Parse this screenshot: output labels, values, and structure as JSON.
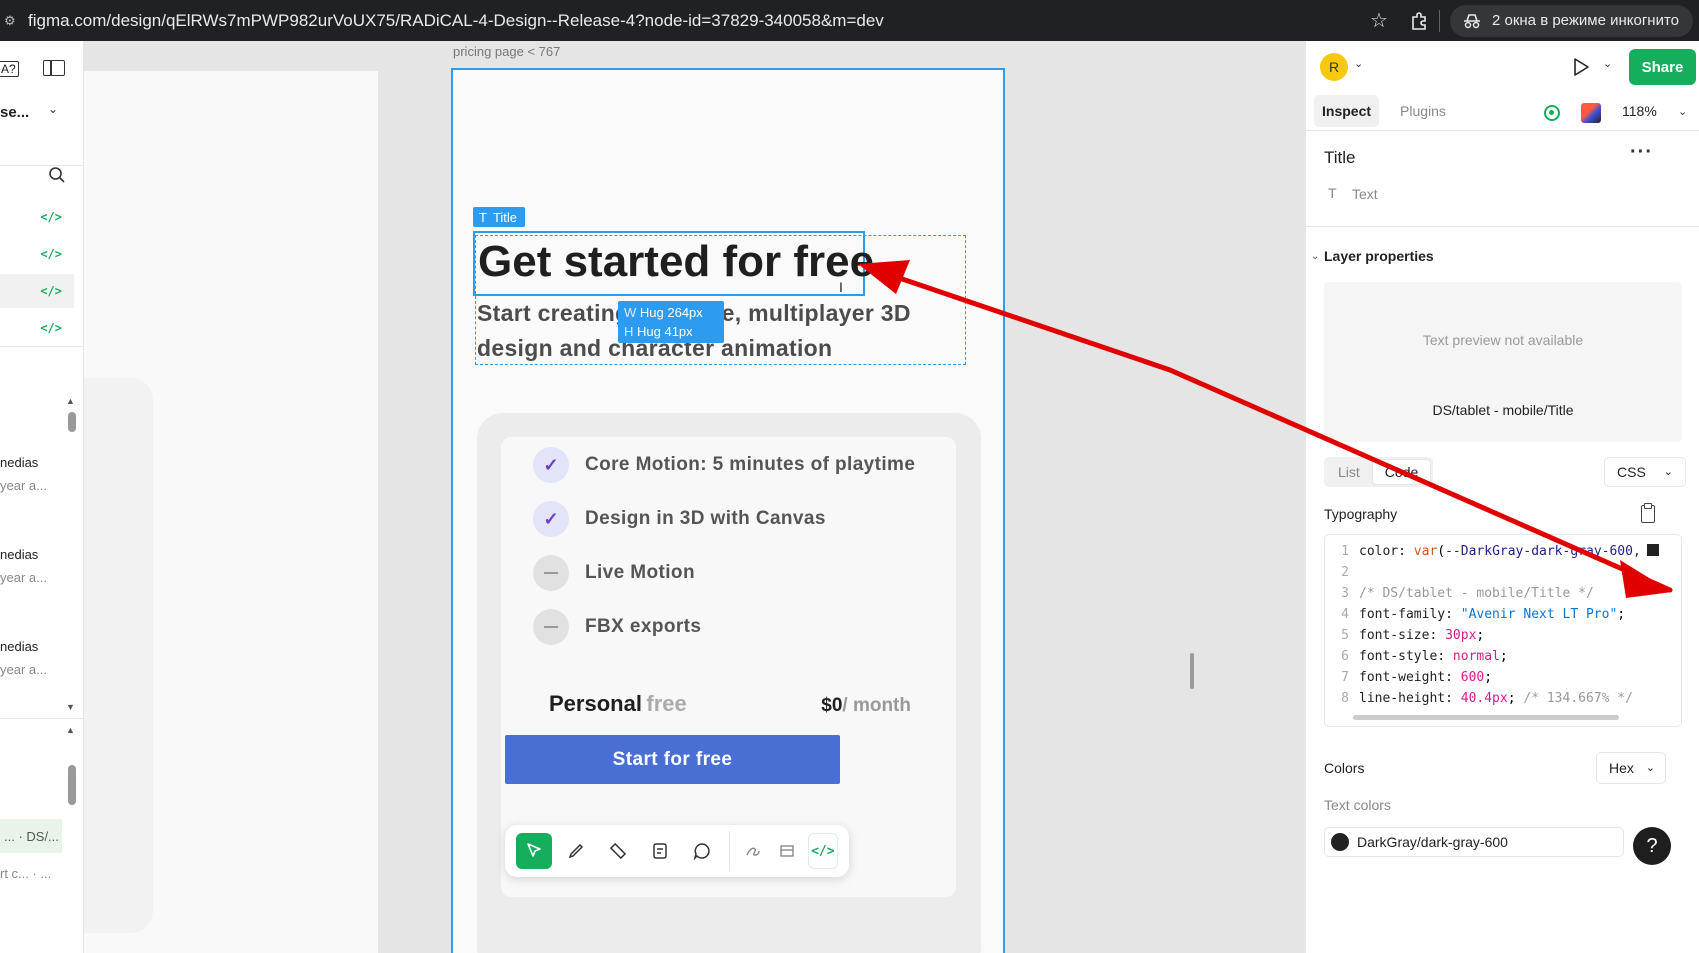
{
  "browser": {
    "url": "figma.com/design/qElRWs7mPWP982urVoUX75/RADiCAL-4-Design--Release-4?node-id=37829-340058&m=dev",
    "incognito_label": "2 окна в режиме инкогнито"
  },
  "left_panel": {
    "file_name": "se...",
    "code_glyph": "</>",
    "items": [
      {
        "title": "nedias",
        "subtitle": "year a..."
      },
      {
        "title": "nedias",
        "subtitle": "year a..."
      },
      {
        "title": "nedias",
        "subtitle": "year a..."
      }
    ],
    "selected_item": "... · DS/...",
    "bottom_item": "rt c... · ..."
  },
  "canvas": {
    "frame_label": "pricing page < 767",
    "title_badge": "Title",
    "title_text": "Get started for free",
    "subtitle_text": "Start creating real-time, multiplayer 3D design and character animation",
    "dim_badge": {
      "w_label": "W",
      "w_value": "Hug 264px",
      "h_label": "H",
      "h_value": "Hug 41px"
    },
    "features": [
      {
        "text": "Core Motion: 5 minutes of playtime",
        "included": true
      },
      {
        "text": "Design in 3D with Canvas",
        "included": true
      },
      {
        "text": "Live Motion",
        "included": false
      },
      {
        "text": "FBX exports",
        "included": false
      }
    ],
    "plan": {
      "name": "Personal",
      "tier": "free",
      "price": "$0",
      "period": "/ month"
    },
    "cta_label": "Start for free",
    "accent_color": "#2d9bf0",
    "button_color": "#4a6fd4"
  },
  "toolbar": {
    "tools": [
      "move-tool",
      "pen-tool",
      "measure-tool",
      "annotate-tool",
      "comment-tool",
      "draw-tool",
      "component-tool",
      "dev-mode-tool"
    ],
    "dev_glyph": "</>"
  },
  "right_panel": {
    "avatar_initial": "R",
    "share_label": "Share",
    "tabs": {
      "inspect": "Inspect",
      "plugins": "Plugins"
    },
    "zoom": "118%",
    "layer_title": "Title",
    "layer_type": "Text",
    "layer_properties_label": "Layer properties",
    "preview_unavailable": "Text preview not available",
    "text_style": "DS/tablet - mobile/Title",
    "view_modes": [
      "List",
      "Code"
    ],
    "code_format": "CSS",
    "typography_label": "Typography",
    "code_lines": [
      {
        "n": "1",
        "text": "color: var(--DarkGray-dark-gray-600, "
      },
      {
        "n": "2",
        "text": ""
      },
      {
        "n": "3",
        "text": "/* DS/tablet - mobile/Title */"
      },
      {
        "n": "4",
        "prop": "font-family: ",
        "val": "\"Avenir Next LT Pro\"",
        "end": ";"
      },
      {
        "n": "5",
        "prop": "font-size: ",
        "val": "30px",
        "end": ";"
      },
      {
        "n": "6",
        "prop": "font-style: ",
        "val": "normal",
        "end": ";"
      },
      {
        "n": "7",
        "prop": "font-weight: ",
        "val": "600",
        "end": ";"
      },
      {
        "n": "8",
        "prop": "line-height: ",
        "val": "40.4px",
        "end": "; ",
        "comment": "/* 134.667% */"
      }
    ],
    "colors_label": "Colors",
    "color_format": "Hex",
    "text_colors_label": "Text colors",
    "text_color_name": "DarkGray/dark-gray-600",
    "help_label": "?"
  }
}
